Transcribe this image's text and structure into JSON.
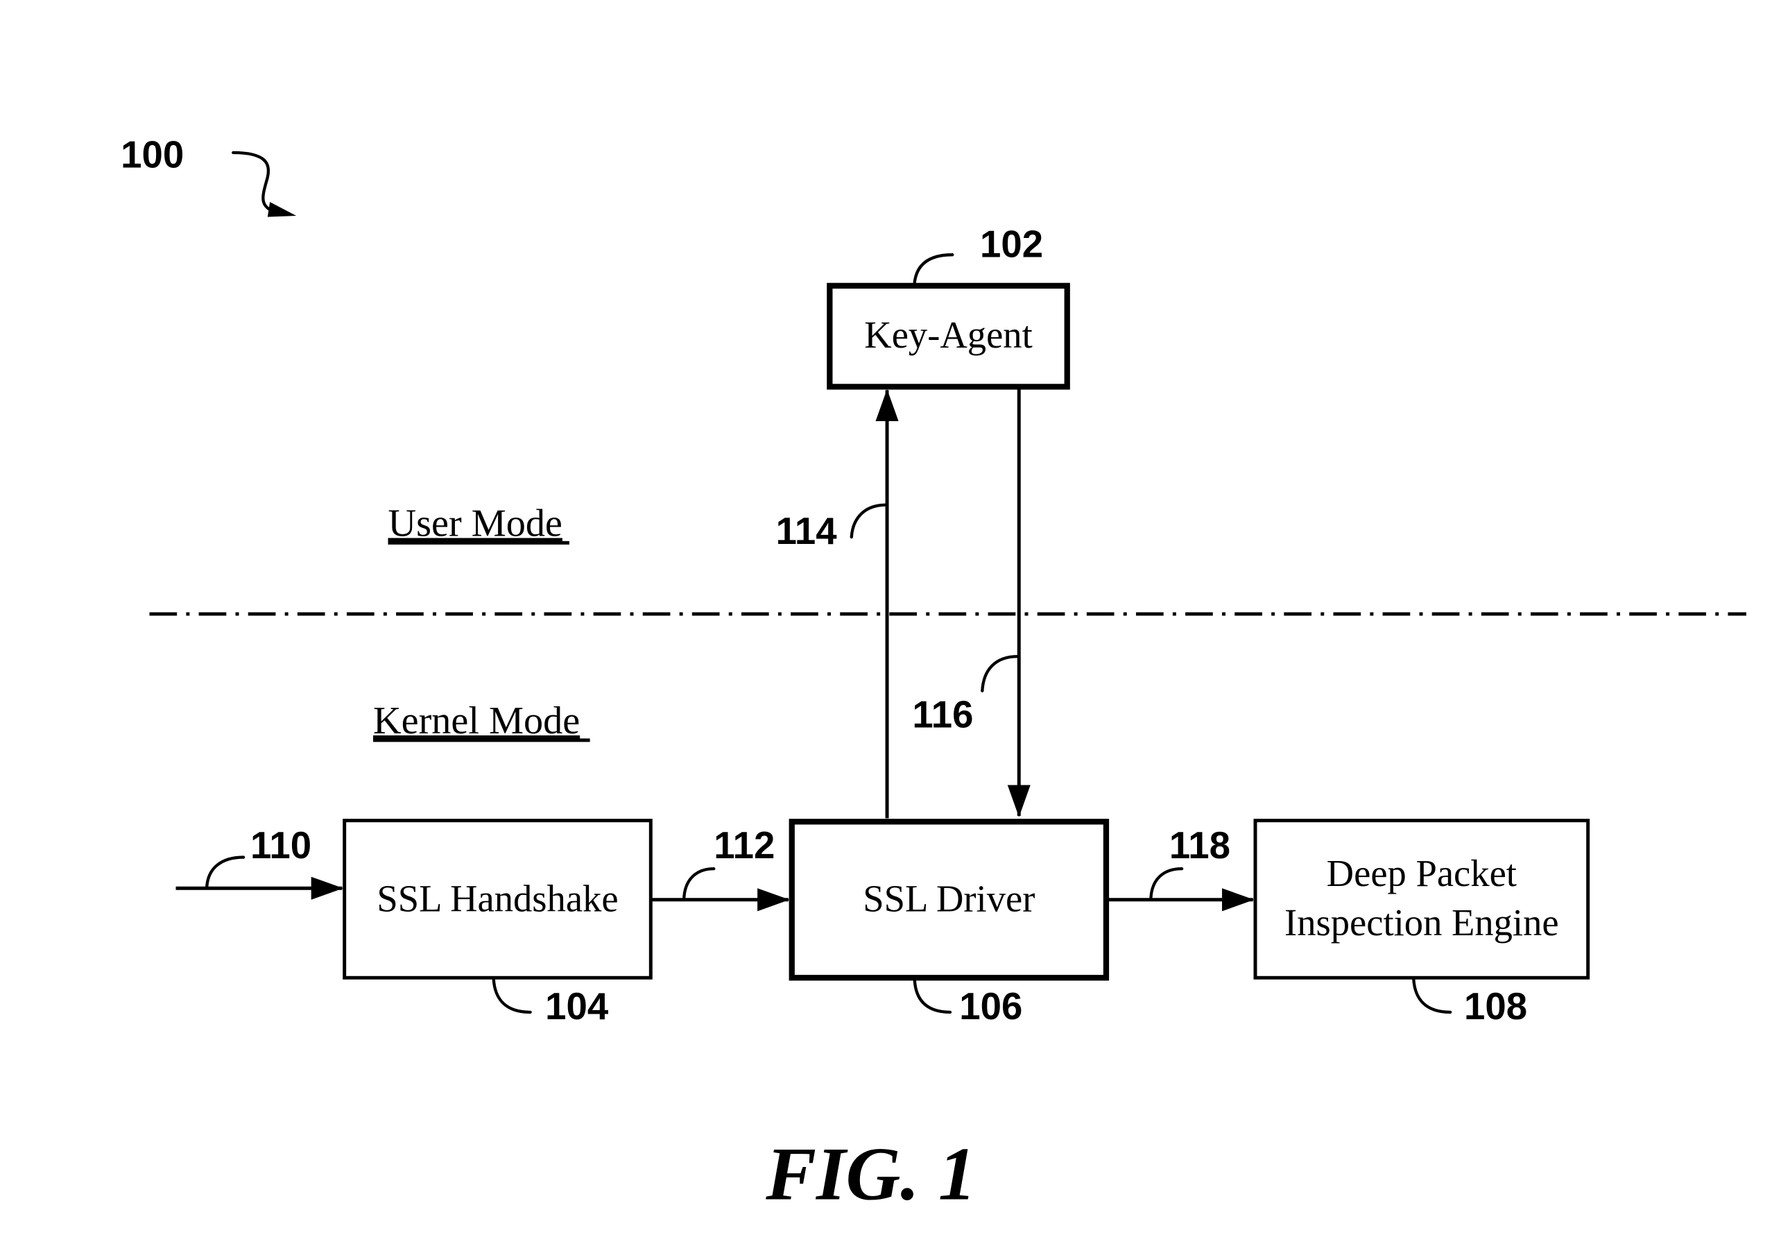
{
  "figure": {
    "caption": "FIG. 1",
    "system_ref": "100"
  },
  "regions": {
    "user_mode": "User Mode",
    "kernel_mode": "Kernel Mode"
  },
  "components": [
    {
      "id": "key_agent",
      "label": "Key-Agent",
      "ref": "102"
    },
    {
      "id": "ssl_handshake",
      "label": "SSL Handshake",
      "ref": "104"
    },
    {
      "id": "ssl_driver",
      "label": "SSL Driver",
      "ref": "106"
    },
    {
      "id": "dpi_engine",
      "label_lines": [
        "Deep Packet",
        "Inspection Engine"
      ],
      "ref": "108"
    }
  ],
  "flows": [
    {
      "ref": "110",
      "from": "input",
      "to": "ssl_handshake"
    },
    {
      "ref": "112",
      "from": "ssl_handshake",
      "to": "ssl_driver"
    },
    {
      "ref": "114",
      "from": "ssl_driver",
      "to": "key_agent"
    },
    {
      "ref": "116",
      "from": "key_agent",
      "to": "ssl_driver"
    },
    {
      "ref": "118",
      "from": "ssl_driver",
      "to": "dpi_engine"
    }
  ]
}
